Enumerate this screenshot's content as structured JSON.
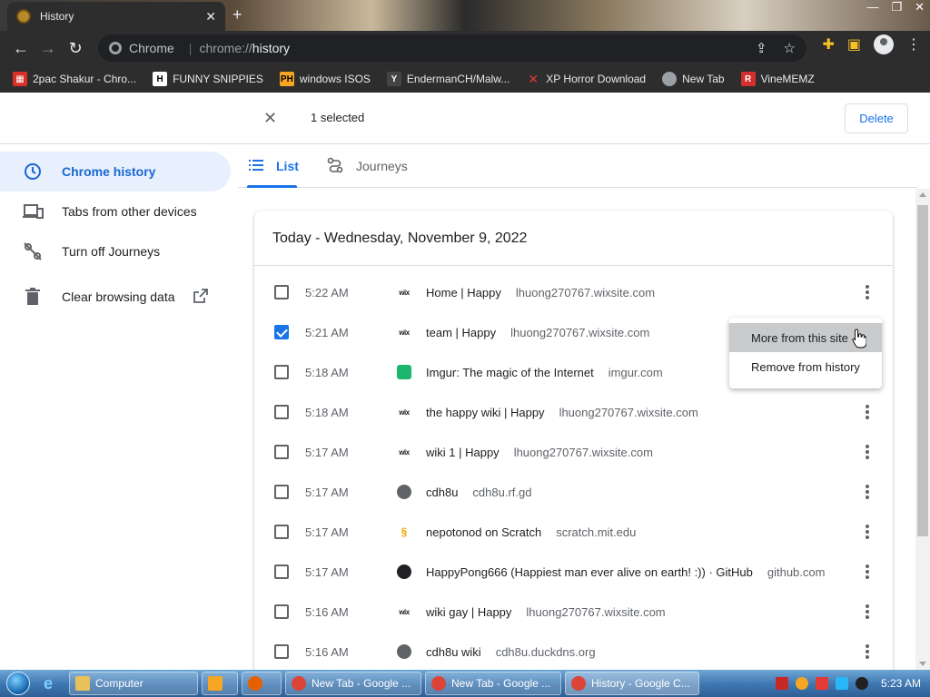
{
  "window": {
    "tab_title": "History",
    "omnibox_site": "Chrome",
    "url_prefix": "chrome://",
    "url_main": "history"
  },
  "bookmarks": [
    {
      "label": "2pac Shakur - Chro...",
      "icon": "app-icon",
      "color": "#d93025"
    },
    {
      "label": "FUNNY SNIPPIES",
      "icon": "h-icon",
      "color": "#ffffff"
    },
    {
      "label": "windows ISOS",
      "icon": "ph-icon",
      "color": "#f6a623"
    },
    {
      "label": "EndermanCH/Malw...",
      "icon": "yp-icon",
      "color": "#444444"
    },
    {
      "label": "XP Horror Download",
      "icon": "x-icon",
      "color": "#e53935"
    },
    {
      "label": "New Tab",
      "icon": "chrome-icon",
      "color": "#9aa0a6"
    },
    {
      "label": "VineMEMZ",
      "icon": "r-icon",
      "color": "#d32f2f"
    }
  ],
  "header": {
    "selected_text": "1 selected",
    "delete_label": "Delete"
  },
  "sidebar": {
    "items": [
      {
        "label": "Chrome history",
        "icon": "clock-icon"
      },
      {
        "label": "Tabs from other devices",
        "icon": "devices-icon"
      },
      {
        "label": "Turn off Journeys",
        "icon": "journeys-off-icon"
      },
      {
        "label": "Clear browsing data",
        "icon": "trash-icon"
      }
    ]
  },
  "tabs": {
    "list": "List",
    "journeys": "Journeys"
  },
  "history": {
    "date_heading": "Today - Wednesday, November 9, 2022",
    "rows": [
      {
        "time": "5:22 AM",
        "title": "Home | Happy",
        "domain": "lhuong270767.wixsite.com",
        "favicon": "wix",
        "checked": false
      },
      {
        "time": "5:21 AM",
        "title": "team | Happy",
        "domain": "lhuong270767.wixsite.com",
        "favicon": "wix",
        "checked": true
      },
      {
        "time": "5:18 AM",
        "title": "Imgur: The magic of the Internet",
        "domain": "imgur.com",
        "favicon": "imgur",
        "checked": false
      },
      {
        "time": "5:18 AM",
        "title": "the happy wiki | Happy",
        "domain": "lhuong270767.wixsite.com",
        "favicon": "wix",
        "checked": false
      },
      {
        "time": "5:17 AM",
        "title": "wiki 1 | Happy",
        "domain": "lhuong270767.wixsite.com",
        "favicon": "wix",
        "checked": false
      },
      {
        "time": "5:17 AM",
        "title": "cdh8u",
        "domain": "cdh8u.rf.gd",
        "favicon": "globe",
        "checked": false
      },
      {
        "time": "5:17 AM",
        "title": "nepotonod on Scratch",
        "domain": "scratch.mit.edu",
        "favicon": "scratch",
        "checked": false
      },
      {
        "time": "5:17 AM",
        "title": "HappyPong666 (Happiest man ever alive on earth! :)) · GitHub",
        "domain": "github.com",
        "favicon": "gh",
        "checked": false
      },
      {
        "time": "5:16 AM",
        "title": "wiki gay | Happy",
        "domain": "lhuong270767.wixsite.com",
        "favicon": "wix",
        "checked": false
      },
      {
        "time": "5:16 AM",
        "title": "cdh8u wiki",
        "domain": "cdh8u.duckdns.org",
        "favicon": "globe",
        "checked": false
      }
    ]
  },
  "context_menu": {
    "more_from_site": "More from this site",
    "remove_from_history": "Remove from history"
  },
  "taskbar": {
    "items": [
      {
        "label": "Computer",
        "color": "#e8c15a"
      },
      {
        "label": "New Tab - Google ...",
        "color": "#db4437"
      },
      {
        "label": "New Tab - Google ...",
        "color": "#db4437"
      },
      {
        "label": "History - Google C...",
        "color": "#db4437"
      }
    ],
    "clock": "5:23 AM"
  },
  "colors": {
    "accent": "#1a73e8",
    "active_sidebar_bg": "#e8f0fe"
  }
}
